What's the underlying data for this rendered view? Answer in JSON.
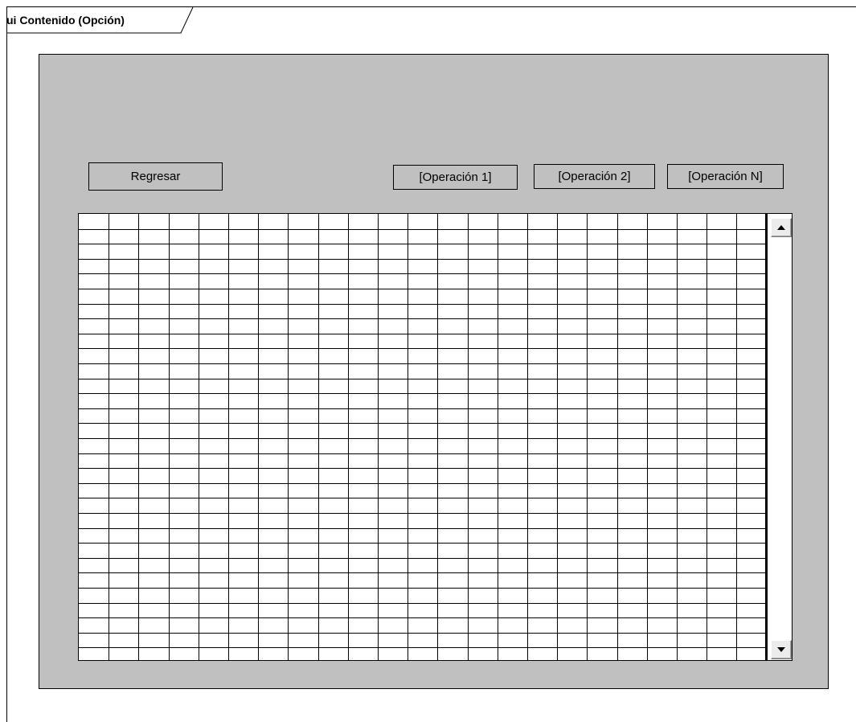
{
  "frame": {
    "label": "ui Contenido (Opción)"
  },
  "window": {
    "back_button": "Regresar",
    "operations": [
      "[Operación 1]",
      "[Operación 2]",
      "[Operación N]"
    ]
  },
  "grid": {
    "columns": 23,
    "rows": 30
  },
  "scrollbar": {
    "up_icon": "arrow-up-icon",
    "down_icon": "arrow-down-icon"
  }
}
